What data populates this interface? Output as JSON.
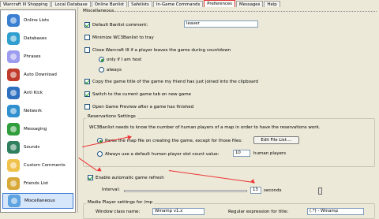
{
  "tabs": [
    "Warcraft III Shopping",
    "Local Database",
    "Online Banlist",
    "Safelists",
    "In-Game Commands",
    "Preferences",
    "Messages",
    "Help"
  ],
  "active_tab": "Preferences",
  "sidebar": {
    "items": [
      {
        "label": "Online Lists",
        "icon": "globe-list-icon",
        "color": "#3b7fd0"
      },
      {
        "label": "Databases",
        "icon": "database-icon",
        "color": "#2e9fcf"
      },
      {
        "label": "Phrases",
        "icon": "phrases-icon",
        "color": "#9c9cf0"
      },
      {
        "label": "Auto Download",
        "icon": "download-icon",
        "color": "#c03b2b"
      },
      {
        "label": "Anti Kick",
        "icon": "anti-kick-icon",
        "color": "#2f6fbf"
      },
      {
        "label": "Network",
        "icon": "network-icon",
        "color": "#2f8fcf"
      },
      {
        "label": "Messaging",
        "icon": "messaging-icon",
        "color": "#2f9d3b"
      },
      {
        "label": "Sounds",
        "icon": "sounds-icon",
        "color": "#2f7f5f"
      },
      {
        "label": "Custom Comments",
        "icon": "comments-icon",
        "color": "#f0c24c"
      },
      {
        "label": "Friends List",
        "icon": "friends-icon",
        "color": "#d8a838"
      },
      {
        "label": "Miscellaneous",
        "icon": "miscellaneous-icon",
        "color": "#5fa3e0"
      }
    ],
    "active": "Miscellaneous"
  },
  "panel": {
    "group_title": "Miscellaneous",
    "default_comment_label": "Default Banlist comment:",
    "default_comment_value": "leaver",
    "minimize_label": "Minimize WC3Banlist to tray",
    "close_wc3_label": "Close Warcraft III if a player leaves the game during countdown",
    "only_host_label": "only if I am host",
    "always_label": "always",
    "copy_title_label": "Copy the game title of the game my friend has just joined into the clipboard",
    "switch_tab_label": "Switch to the current game tab on new game",
    "open_preview_label": "Open Game Preview after a game has finished",
    "reservations": {
      "title": "Reservations Settings",
      "description": "WC3Banlist needs to know the number of human players of a map in order to have the reservations work.",
      "parse_map_label": "Parse the map file on creating the game, except for those files:",
      "edit_file_list": "Edit File List....",
      "always_default_label": "Always use a default human player slot count value:",
      "slot_count": "10",
      "human_players": "human players"
    },
    "refresh": {
      "enable_label": "Enable automatic game refresh",
      "interval_label": "Interval:",
      "interval_value": "13",
      "seconds": "seconds",
      "slider_fraction": 0.98
    },
    "media_player": {
      "title": "Media Player settings for /mp",
      "window_class_label": "Window class name:",
      "window_class_value": "Winamp v1.x",
      "regex_label": "Regular expression for title:",
      "regex_value": "(.*) - Winamp"
    }
  },
  "colors": {
    "annotation_red": "#ee3333",
    "highlight_blue": "#3c7bd5"
  }
}
